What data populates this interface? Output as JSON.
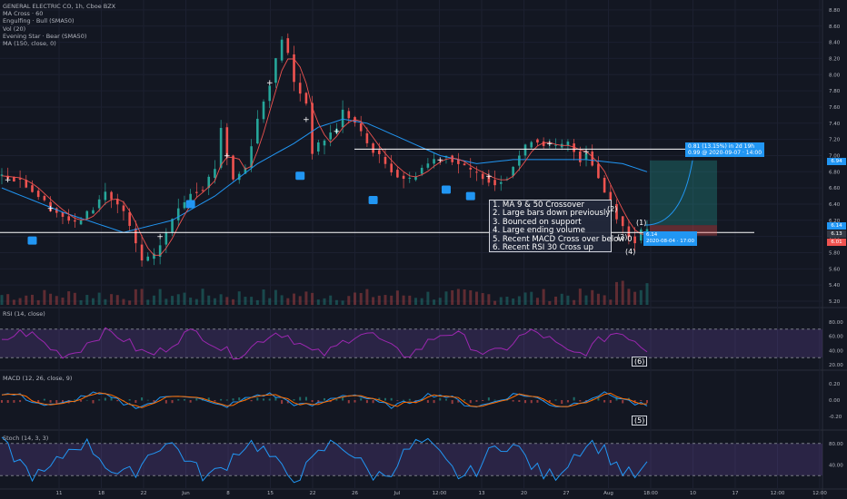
{
  "legend": {
    "symbol": "GENERAL ELECTRIC CO, 1h, Cboe BZX",
    "indicators": [
      "MA Cross · 60",
      "Engulfing · Bull (SMA50)",
      "Vol (20)",
      "Evening Star · Bear (SMA50)",
      "MA (150, close, 0)"
    ]
  },
  "notes": [
    "1. MA 9 & 50 Crossover",
    "2. Large bars down previously",
    "3. Bounced on support",
    "4. Large ending volume",
    "5. Recent MACD Cross over below 0",
    "6. Recent RSI 30 Cross up"
  ],
  "markers": {
    "m1": "(1)",
    "m2": "(2)",
    "m3": "(3)",
    "m4": "(4)",
    "m5": "(5)",
    "m6": "(6)"
  },
  "position": {
    "target_text": "0.81 (13.15%) in 2d 19h",
    "target_sub": "0.99 @ 2020-09-07 · 14:00",
    "entry_text": "6.14",
    "entry_sub": "2020-08-04 · 17:00"
  },
  "panes": {
    "rsi": "RSI (14, close)",
    "macd": "MACD (12, 26, close, 9)",
    "stoch": "Stoch (14, 3, 3)"
  },
  "price_labels": [
    {
      "text": "6.94",
      "color": "#2196f3"
    },
    {
      "text": "6.14",
      "color": "#2196f3"
    },
    {
      "text": "6.13",
      "color": "#363a45"
    },
    {
      "text": "6.01",
      "color": "#ef5350"
    }
  ],
  "colors": {
    "up": "#26a69a",
    "down": "#ef5350",
    "ma_fast": "#ef5350",
    "ma_slow": "#2196f3",
    "rsi": "#9c27b0",
    "macd": "#2196f3",
    "signal": "#ff6d00",
    "stoch_k": "#2196f3",
    "stoch_d": "#ff6d00",
    "band": "#7e57c2"
  },
  "chart_data": [
    {
      "type": "line",
      "title": "GENERAL ELECTRIC CO, 1h, Cboe BZX",
      "x_ticks": [
        "11",
        "18",
        "22",
        "Jun",
        "8",
        "15",
        "22",
        "26",
        "Jul",
        "12:00",
        "13",
        "20",
        "27",
        "Aug",
        "18:00",
        "10",
        "17",
        "12:00",
        "12:00"
      ],
      "y_ticks": [
        "5.20",
        "5.40",
        "5.60",
        "5.80",
        "6.00",
        "6.20",
        "6.40",
        "6.60",
        "6.80",
        "7.00",
        "7.20",
        "7.40",
        "7.60",
        "7.80",
        "8.00",
        "8.20",
        "8.40",
        "8.60",
        "8.80"
      ],
      "ylim": [
        5.2,
        8.9
      ],
      "price_waypoints": [
        [
          0,
          6.75
        ],
        [
          3,
          6.7
        ],
        [
          6,
          6.5
        ],
        [
          8,
          6.35
        ],
        [
          10,
          6.25
        ],
        [
          12,
          6.15
        ],
        [
          15,
          6.35
        ],
        [
          17,
          6.55
        ],
        [
          20,
          6.3
        ],
        [
          23,
          5.7
        ],
        [
          25,
          5.75
        ],
        [
          27,
          6.05
        ],
        [
          29,
          6.35
        ],
        [
          31,
          6.55
        ],
        [
          33,
          6.6
        ],
        [
          35,
          6.85
        ],
        [
          36,
          7.35
        ],
        [
          37,
          7.0
        ],
        [
          38,
          6.7
        ],
        [
          40,
          6.85
        ],
        [
          42,
          7.45
        ],
        [
          44,
          7.9
        ],
        [
          46,
          8.45
        ],
        [
          47,
          8.25
        ],
        [
          48,
          7.9
        ],
        [
          50,
          7.65
        ],
        [
          51,
          7.05
        ],
        [
          53,
          7.2
        ],
        [
          55,
          7.35
        ],
        [
          56,
          7.55
        ],
        [
          58,
          7.4
        ],
        [
          60,
          7.15
        ],
        [
          63,
          6.9
        ],
        [
          65,
          6.75
        ],
        [
          67,
          6.7
        ],
        [
          69,
          6.85
        ],
        [
          71,
          6.95
        ],
        [
          73,
          7.0
        ],
        [
          75,
          6.9
        ],
        [
          77,
          6.8
        ],
        [
          79,
          6.75
        ],
        [
          81,
          6.65
        ],
        [
          83,
          6.75
        ],
        [
          85,
          7.0
        ],
        [
          87,
          7.2
        ],
        [
          89,
          7.15
        ],
        [
          91,
          7.1
        ],
        [
          93,
          7.15
        ],
        [
          95,
          6.95
        ],
        [
          96,
          7.05
        ],
        [
          97,
          6.9
        ],
        [
          99,
          6.55
        ],
        [
          101,
          6.25
        ],
        [
          103,
          6.0
        ],
        [
          104,
          5.95
        ],
        [
          105,
          6.05
        ],
        [
          106,
          6.1
        ]
      ],
      "ma150_waypoints": [
        [
          0,
          6.6
        ],
        [
          10,
          6.3
        ],
        [
          20,
          6.05
        ],
        [
          28,
          6.2
        ],
        [
          35,
          6.5
        ],
        [
          42,
          6.9
        ],
        [
          48,
          7.15
        ],
        [
          52,
          7.35
        ],
        [
          56,
          7.45
        ],
        [
          60,
          7.4
        ],
        [
          66,
          7.2
        ],
        [
          72,
          7.0
        ],
        [
          78,
          6.9
        ],
        [
          84,
          6.95
        ],
        [
          90,
          6.95
        ],
        [
          96,
          6.95
        ],
        [
          102,
          6.9
        ],
        [
          106,
          6.8
        ]
      ],
      "horizontal_levels": [
        6.05,
        7.08
      ],
      "position_box": {
        "entry": 6.14,
        "target": 6.94,
        "stop": 6.01
      }
    },
    {
      "type": "line",
      "title": "RSI (14, close)",
      "y_ticks": [
        "20.00",
        "40.00",
        "60.00",
        "80.00"
      ],
      "band": [
        30,
        70
      ],
      "last": 45
    },
    {
      "type": "bar",
      "title": "MACD (12, 26, close, 9)",
      "y_ticks": [
        "-0.20",
        "0.00",
        "0.20"
      ],
      "last": 0.0
    },
    {
      "type": "line",
      "title": "Stoch (14, 3, 3)",
      "y_ticks": [
        "40.00",
        "80.00"
      ],
      "band": [
        20,
        80
      ],
      "last": 70
    }
  ]
}
